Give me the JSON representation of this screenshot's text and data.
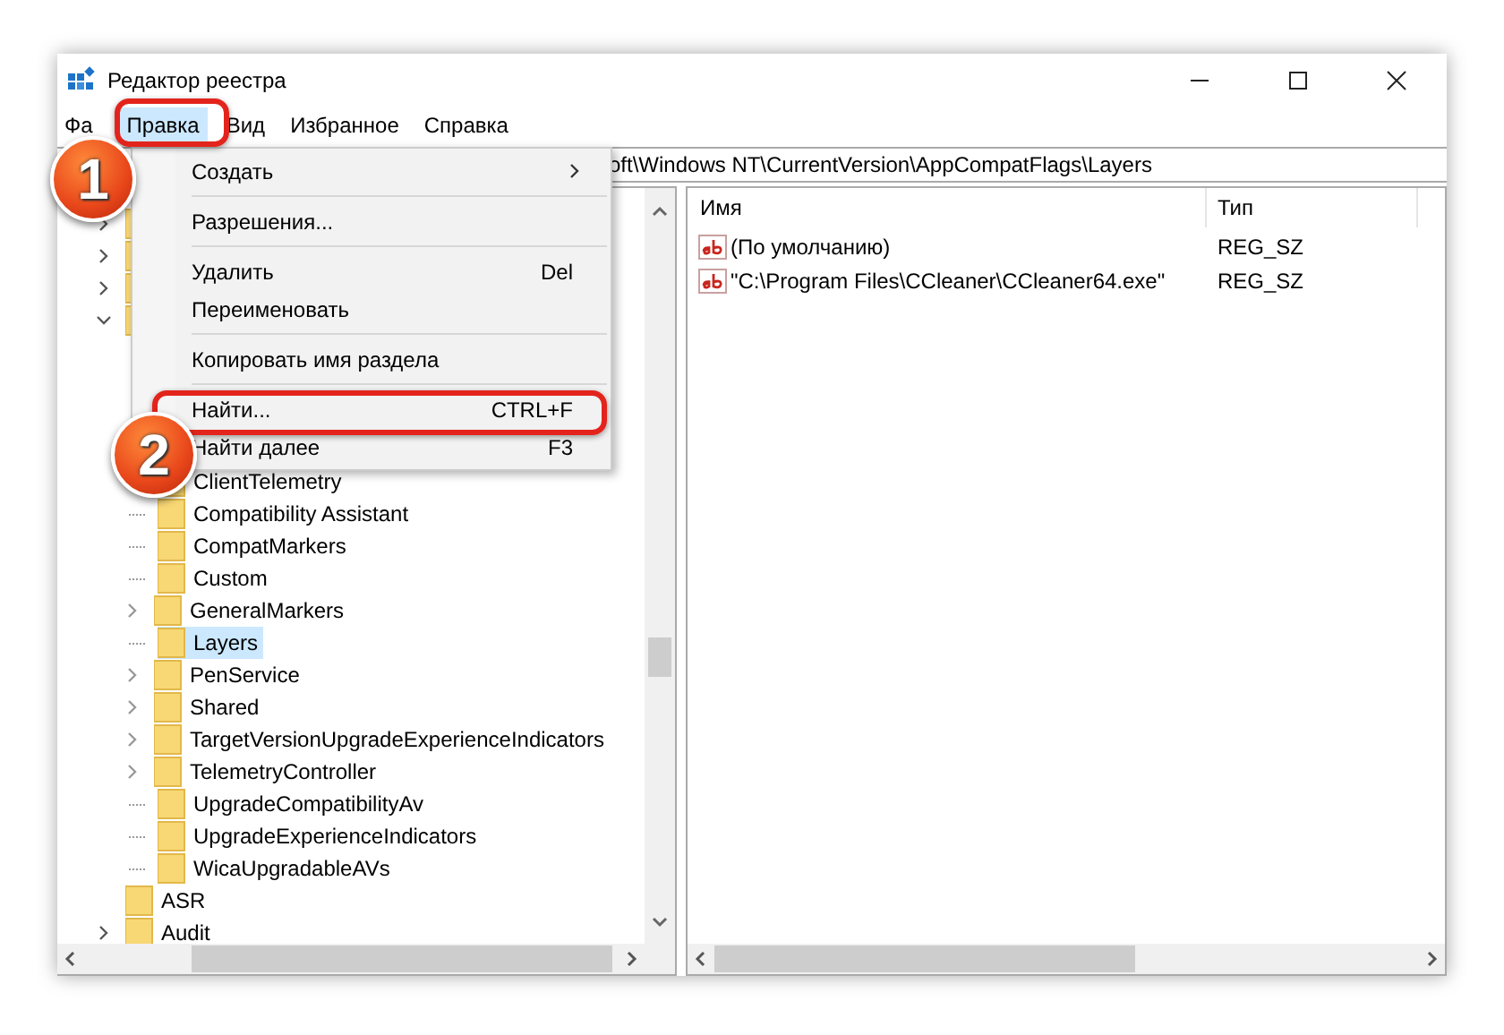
{
  "window": {
    "title": "Редактор реестра"
  },
  "menu_bar": [
    {
      "label": "Фа",
      "selected": false
    },
    {
      "label": "Правка",
      "selected": true
    },
    {
      "label": "Вид",
      "selected": false
    },
    {
      "label": "Избранное",
      "selected": false
    },
    {
      "label": "Справка",
      "selected": false
    }
  ],
  "address": "oft\\Windows NT\\CurrentVersion\\AppCompatFlags\\Layers",
  "tree": [
    {
      "expanded": false
    },
    {
      "expanded": false
    },
    {
      "expanded": false
    },
    {
      "expanded": true,
      "children": [
        {
          "label": "ClientTelemetry",
          "expandable": false,
          "selected": false
        },
        {
          "label": "Compatibility Assistant",
          "expandable": false,
          "selected": false
        },
        {
          "label": "CompatMarkers",
          "expandable": false,
          "selected": false
        },
        {
          "label": "Custom",
          "expandable": false,
          "selected": false
        },
        {
          "label": "GeneralMarkers",
          "expandable": true,
          "selected": false
        },
        {
          "label": "Layers",
          "expandable": false,
          "selected": true
        },
        {
          "label": "PenService",
          "expandable": true,
          "selected": false
        },
        {
          "label": "Shared",
          "expandable": true,
          "selected": false
        },
        {
          "label": "TargetVersionUpgradeExperienceIndicators",
          "expandable": true,
          "selected": false
        },
        {
          "label": "TelemetryController",
          "expandable": true,
          "selected": false
        },
        {
          "label": "UpgradeCompatibilityAv",
          "expandable": false,
          "selected": false
        },
        {
          "label": "UpgradeExperienceIndicators",
          "expandable": false,
          "selected": false
        },
        {
          "label": "WicaUpgradableAVs",
          "expandable": false,
          "selected": false
        }
      ]
    },
    {
      "label": "ASR",
      "expanded": false,
      "expandable": false
    },
    {
      "label": "Audit",
      "expanded": false,
      "expandable": true
    }
  ],
  "values_table": {
    "columns": [
      "Имя",
      "Тип"
    ],
    "rows": [
      {
        "name": "(По умолчанию)",
        "type": "REG_SZ"
      },
      {
        "name": "\"C:\\Program Files\\CCleaner\\CCleaner64.exe\"",
        "type": "REG_SZ"
      }
    ]
  },
  "edit_menu": [
    {
      "kind": "item",
      "label": "Создать",
      "submenu": true
    },
    {
      "kind": "separator"
    },
    {
      "kind": "item",
      "label": "Разрешения..."
    },
    {
      "kind": "separator"
    },
    {
      "kind": "item",
      "label": "Удалить",
      "shortcut": "Del"
    },
    {
      "kind": "item",
      "label": "Переименовать"
    },
    {
      "kind": "separator"
    },
    {
      "kind": "item",
      "label": "Копировать имя раздела"
    },
    {
      "kind": "separator"
    },
    {
      "kind": "item",
      "label": "Найти...",
      "shortcut": "CTRL+F"
    },
    {
      "kind": "item",
      "label": "Найти далее",
      "shortcut": "F3"
    }
  ],
  "callouts": [
    {
      "label": "1"
    },
    {
      "label": "2"
    }
  ]
}
